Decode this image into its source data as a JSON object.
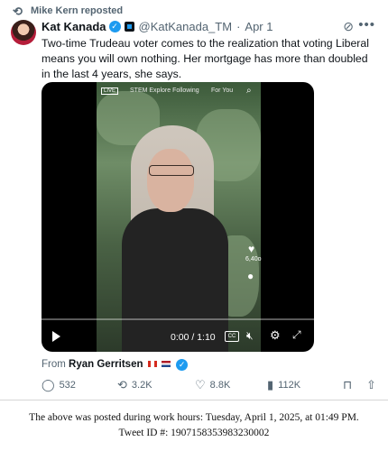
{
  "repost": {
    "label": "Mike Kern reposted",
    "icon": "repost-icon"
  },
  "author": {
    "name": "Kat Kanada",
    "handle": "@KatKanada_TM",
    "date": "Apr 1",
    "separator": "·"
  },
  "post_text": "Two-time Trudeau voter comes to the realization that voting Liberal means you will own nothing. Her mortgage has more than doubled in the last 4 years, she says.",
  "video": {
    "tabs_text": "STEM  Explore  Following",
    "for_you": "For You",
    "live": "LIVE",
    "likes_count": "6,40o",
    "time": "0:00 / 1:10",
    "cc": "CC",
    "progress_fraction": 0.0
  },
  "from": {
    "label": "From",
    "name": "Ryan Gerritsen"
  },
  "actions": {
    "replies": "532",
    "reposts": "3.2K",
    "likes": "8.8K",
    "views": "112K"
  },
  "footer": {
    "line1": "The above was posted during work hours: Tuesday, April 1, 2025, at 01:49 PM.",
    "line2": "Tweet ID #: 1907158353983230002"
  },
  "colors": {
    "accent": "#1d9bf0",
    "muted": "#536471",
    "text": "#0f1419"
  }
}
